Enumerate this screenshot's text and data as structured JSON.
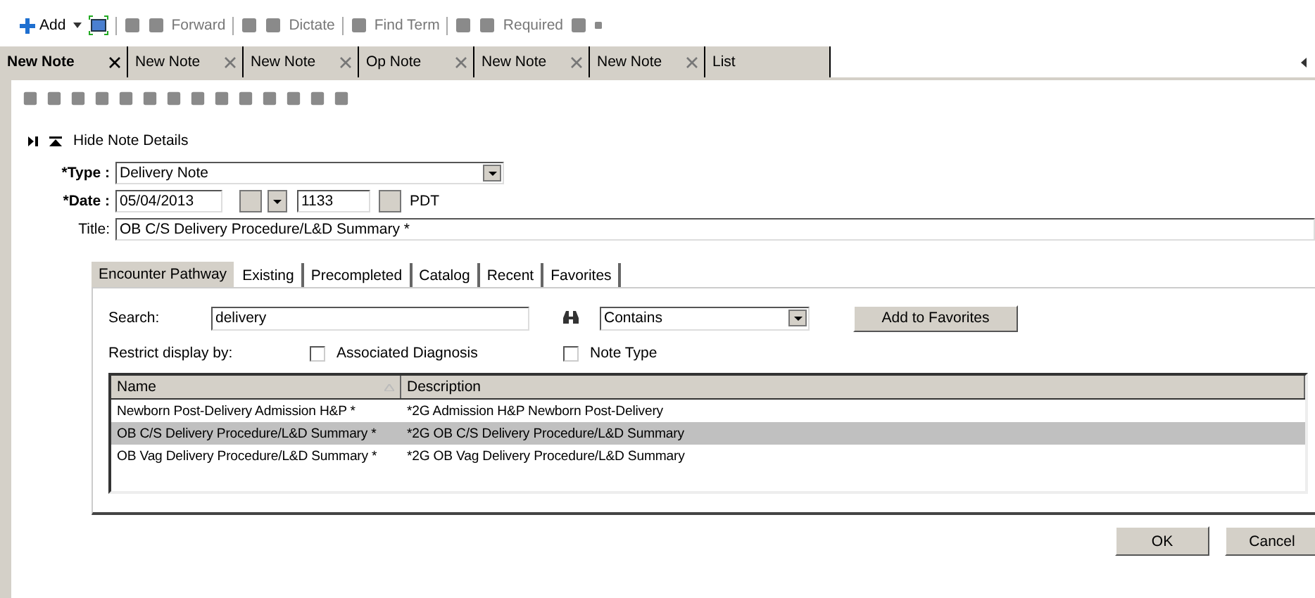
{
  "toolbar": [
    {
      "label": "Add",
      "disabled": false
    },
    {
      "label": "Forward",
      "disabled": true
    },
    {
      "label": "Dictate",
      "disabled": true
    },
    {
      "label": "Find Term",
      "disabled": true
    },
    {
      "label": "Required",
      "disabled": true
    }
  ],
  "doc_tabs": [
    {
      "label": "New Note",
      "selected": true
    },
    {
      "label": "New Note",
      "selected": false
    },
    {
      "label": "New Note",
      "selected": false
    },
    {
      "label": "Op Note",
      "selected": false
    },
    {
      "label": "New Note",
      "selected": false
    },
    {
      "label": "New Note",
      "selected": false
    },
    {
      "label": "List",
      "selected": false
    }
  ],
  "details_toggle": "Hide Note Details",
  "type": {
    "label": "*Type :",
    "value": "Delivery Note"
  },
  "date": {
    "label": "*Date :",
    "value": "05/04/2013",
    "time": "1133",
    "zone": "PDT"
  },
  "title": {
    "label": "Title:",
    "value": "OB C/S Delivery Procedure/L&D Summary *"
  },
  "tabs": [
    {
      "label": "Encounter Pathway",
      "selected": true
    },
    {
      "label": "Existing",
      "selected": false
    },
    {
      "label": "Precompleted",
      "selected": false
    },
    {
      "label": "Catalog",
      "selected": false
    },
    {
      "label": "Recent",
      "selected": false
    },
    {
      "label": "Favorites",
      "selected": false
    }
  ],
  "search": {
    "label": "Search:",
    "value": "delivery",
    "match": "Contains",
    "favorites_button": "Add to Favorites"
  },
  "restrict": {
    "label": "Restrict display by:",
    "options": [
      {
        "label": "Associated Diagnosis",
        "checked": false
      },
      {
        "label": "Note Type",
        "checked": false
      }
    ]
  },
  "table": {
    "columns": [
      "Name",
      "Description"
    ],
    "rows": [
      {
        "cells": [
          "Newborn Post-Delivery Admission H&P *",
          "*2G Admission H&P Newborn Post-Delivery"
        ],
        "selected": false
      },
      {
        "cells": [
          "OB C/S Delivery Procedure/L&D Summary *",
          "*2G OB C/S Delivery Procedure/L&D Summary"
        ],
        "selected": true
      },
      {
        "cells": [
          "OB Vag Delivery Procedure/L&D Summary *",
          "*2G OB Vag Delivery Procedure/L&D Summary"
        ],
        "selected": false
      }
    ]
  },
  "buttons": [
    "OK",
    "Cancel"
  ]
}
